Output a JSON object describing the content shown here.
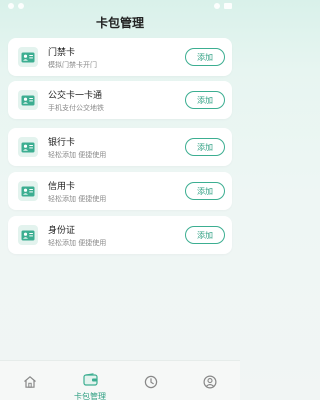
{
  "header": {
    "title": "卡包管理"
  },
  "cards": [
    {
      "title": "门禁卡",
      "subtitle": "模拟门禁卡开门",
      "button": "添加",
      "icon": "id-card-icon"
    },
    {
      "title": "公交卡一卡通",
      "subtitle": "手机支付公交地铁",
      "button": "添加",
      "icon": "id-card-icon"
    },
    {
      "title": "银行卡",
      "subtitle": "轻松添加 便捷使用",
      "button": "添加",
      "icon": "id-card-icon"
    },
    {
      "title": "信用卡",
      "subtitle": "轻松添加 便捷使用",
      "button": "添加",
      "icon": "id-card-icon"
    },
    {
      "title": "身份证",
      "subtitle": "轻松添加 便捷使用",
      "button": "添加",
      "icon": "id-card-icon"
    }
  ],
  "nav": {
    "items": [
      {
        "icon": "home-icon",
        "label": ""
      },
      {
        "icon": "wallet-icon",
        "label": "卡包管理",
        "active": true
      },
      {
        "icon": "clock-icon",
        "label": ""
      },
      {
        "icon": "user-icon",
        "label": ""
      }
    ]
  },
  "colors": {
    "accent": "#3cae91",
    "icon_bg": "#e3f3ee",
    "background": "#eef6f4"
  }
}
